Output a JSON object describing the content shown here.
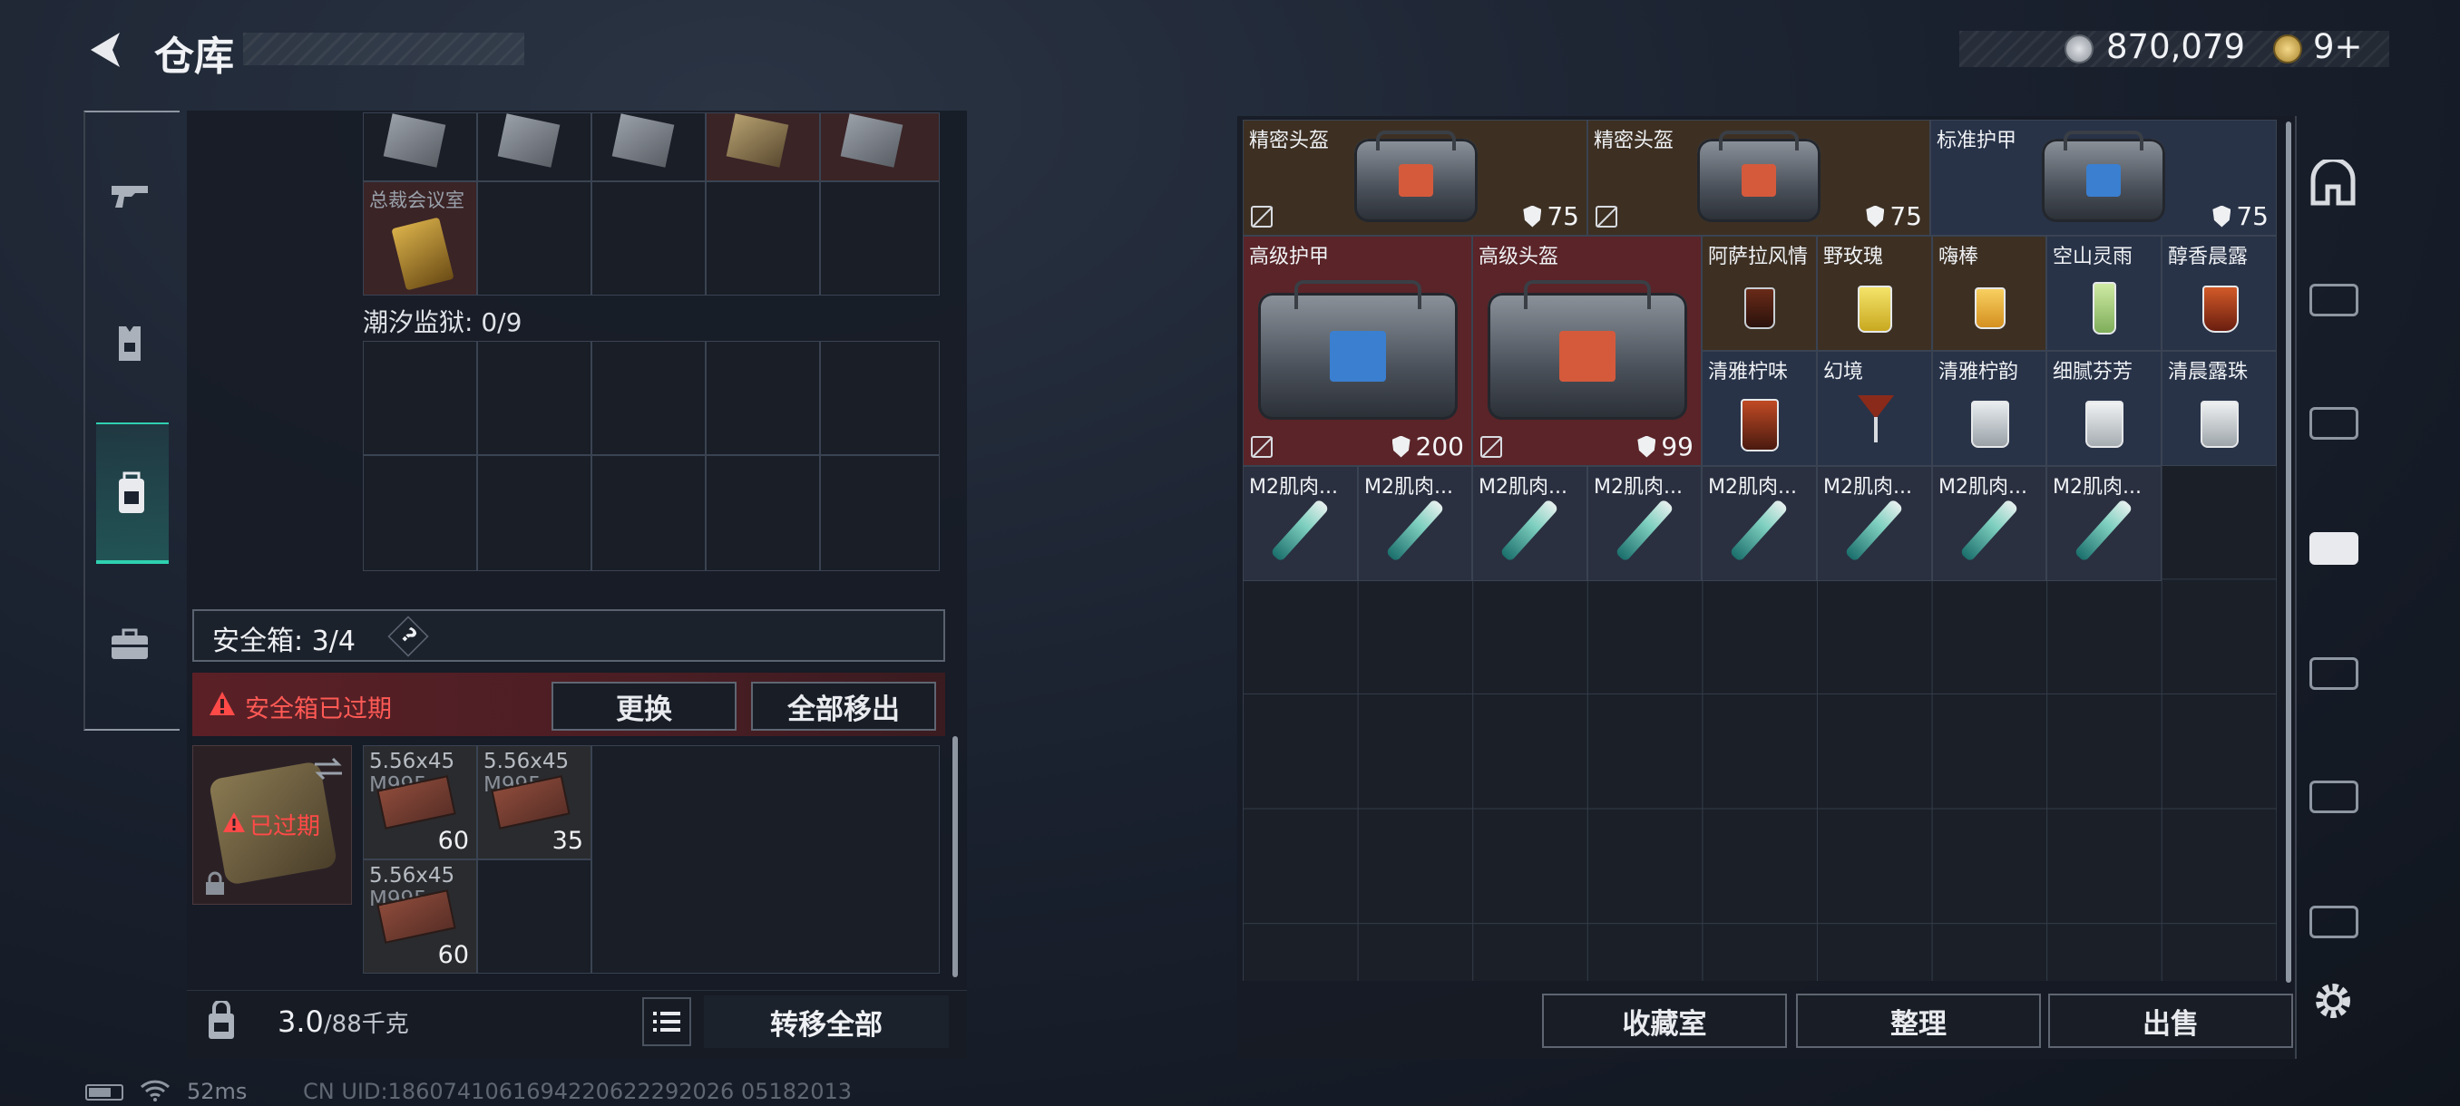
{
  "header": {
    "title": "仓库",
    "currency": "870,079",
    "tickets": "9+"
  },
  "left_panel": {
    "row_label": "总裁会议室",
    "prison_label": "潮汐监狱: 0/9",
    "safe_box_label": "安全箱: 3/4",
    "help": "?",
    "expired_warning": "安全箱已过期",
    "replace_button": "更换",
    "move_all_button": "全部移出",
    "expired_badge": "已过期",
    "ammo": [
      {
        "name": "5.56x45",
        "sub": "M995",
        "count": "60"
      },
      {
        "name": "5.56x45",
        "sub": "M995",
        "count": "35"
      },
      {
        "name": "5.56x45",
        "sub": "M995",
        "count": "60"
      }
    ],
    "weight_value": "3.0",
    "weight_max": "/88千克",
    "transfer_all_button": "转移全部"
  },
  "status_bar": {
    "ping": "52ms",
    "uid": "CN UID:1860741061694220622292026 05182013"
  },
  "stash": {
    "items": [
      {
        "name": "精密头盔",
        "value": "75"
      },
      {
        "name": "精密头盔",
        "value": "75"
      },
      {
        "name": "标准护甲",
        "value": "75"
      },
      {
        "name": "高级护甲",
        "value": "200"
      },
      {
        "name": "高级头盔",
        "value": "99"
      },
      {
        "name": "阿萨拉风情"
      },
      {
        "name": "野玫瑰"
      },
      {
        "name": "嗨棒"
      },
      {
        "name": "空山灵雨"
      },
      {
        "name": "醇香晨露"
      },
      {
        "name": "清雅柠味"
      },
      {
        "name": "幻境"
      },
      {
        "name": "清雅柠韵"
      },
      {
        "name": "细腻芬芳"
      },
      {
        "name": "清晨露珠"
      },
      {
        "name": "M2肌肉..."
      },
      {
        "name": "M2肌肉..."
      },
      {
        "name": "M2肌肉..."
      },
      {
        "name": "M2肌肉..."
      },
      {
        "name": "M2肌肉..."
      },
      {
        "name": "M2肌肉..."
      },
      {
        "name": "M2肌肉..."
      },
      {
        "name": "M2肌肉..."
      }
    ]
  },
  "bottom_buttons": {
    "collection": "收藏室",
    "organize": "整理",
    "sell": "出售"
  },
  "colors": {
    "accent": "#2fd0b0",
    "danger": "#ff4a48",
    "gold": "#6a4a2a",
    "red_bg": "#5a2428",
    "blue_bg": "#283348"
  }
}
